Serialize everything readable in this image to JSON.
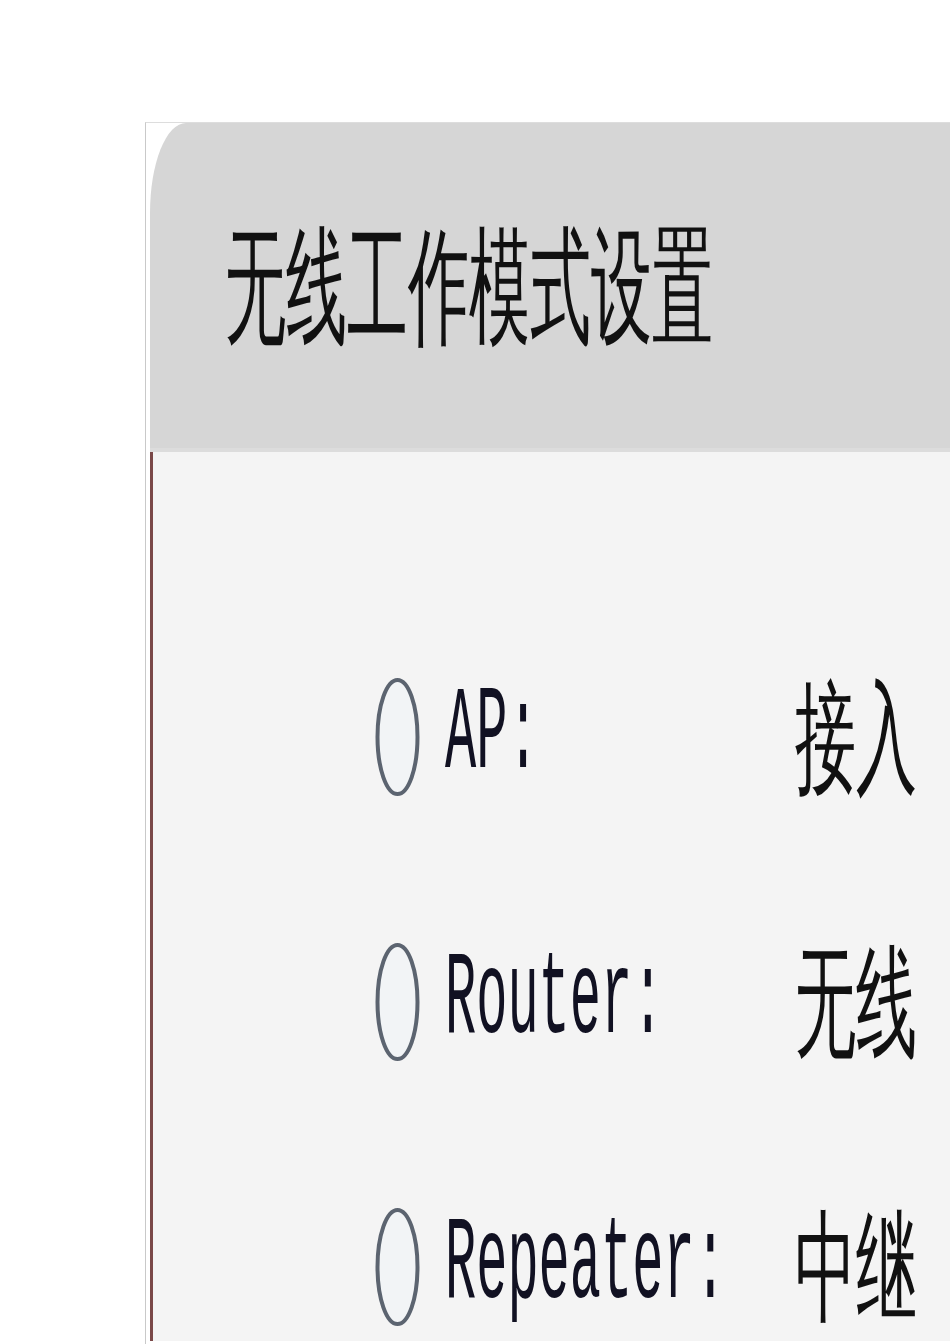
{
  "panel": {
    "title": "无线工作模式设置",
    "options": [
      {
        "label": "AP:",
        "description": "接入",
        "selected": false
      },
      {
        "label": "Router:",
        "description": "无线",
        "selected": false
      },
      {
        "label": "Repeater:",
        "description": "中继",
        "selected": false
      }
    ]
  }
}
